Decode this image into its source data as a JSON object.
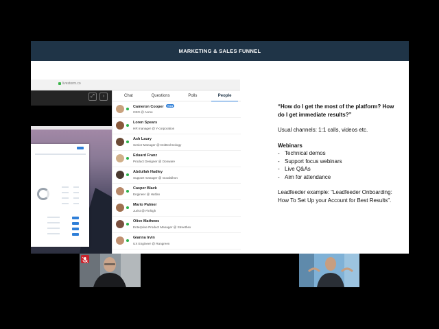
{
  "slide": {
    "title": "MARKETING & SALES FUNNEL",
    "url": "livestorm.co"
  },
  "panel": {
    "tabs": [
      {
        "label": "Chat",
        "active": false
      },
      {
        "label": "Questions",
        "active": false
      },
      {
        "label": "Polls",
        "active": false
      },
      {
        "label": "People",
        "active": true
      }
    ],
    "people": [
      {
        "name": "Cameron Cooper",
        "role": "CEO @ Acme",
        "badge": "YOU",
        "avatar_color": "#c9a27e"
      },
      {
        "name": "Loren Spears",
        "role": "HR manager @ Y-corporation",
        "badge": "",
        "avatar_color": "#8a5a3c"
      },
      {
        "name": "Ash Laury",
        "role": "Senior Manager @ Dolttechnology",
        "badge": "",
        "avatar_color": "#6a4a36"
      },
      {
        "name": "Eduard Franz",
        "role": "Product Designer @ Donware",
        "badge": "",
        "avatar_color": "#d1b08a"
      },
      {
        "name": "Abdullah Hadley",
        "role": "Support manager @ Goodsilron",
        "badge": "",
        "avatar_color": "#4a3a30"
      },
      {
        "name": "Casper Black",
        "role": "Engineer @ Hatfan",
        "badge": "",
        "avatar_color": "#b8896a"
      },
      {
        "name": "Mario Palmer",
        "role": "Jurist @ Finhigh",
        "badge": "",
        "avatar_color": "#a07050"
      },
      {
        "name": "Olive Mathews",
        "role": "Enterprise Product Manager @ Streethex",
        "badge": "",
        "avatar_color": "#7a5040"
      },
      {
        "name": "Gianna Irvin",
        "role": "UX Engineer @ Rangreen",
        "badge": "",
        "avatar_color": "#c09070"
      }
    ]
  },
  "notes": {
    "question": "“How do I get the most of the platform? How do I get immediate results?”",
    "channels": "Usual channels: 1:1 calls, videos etc.",
    "webinars_heading": "Webinars",
    "webinars": [
      "Technical demos",
      "Support focus webinars",
      "Live Q&As",
      "Aim for attendance"
    ],
    "example": "Leadfeeder example: “Leadfeeder Onboarding: How To Set Up your Account for Best Results”."
  },
  "colors": {
    "header": "#1f3447",
    "accent": "#2f7fd8",
    "online": "#2fb24c",
    "mic_off": "#c8232c"
  },
  "icons": {
    "expand": "expand-icon",
    "next": "chevron-right-icon",
    "mic": "mic-off-icon"
  }
}
